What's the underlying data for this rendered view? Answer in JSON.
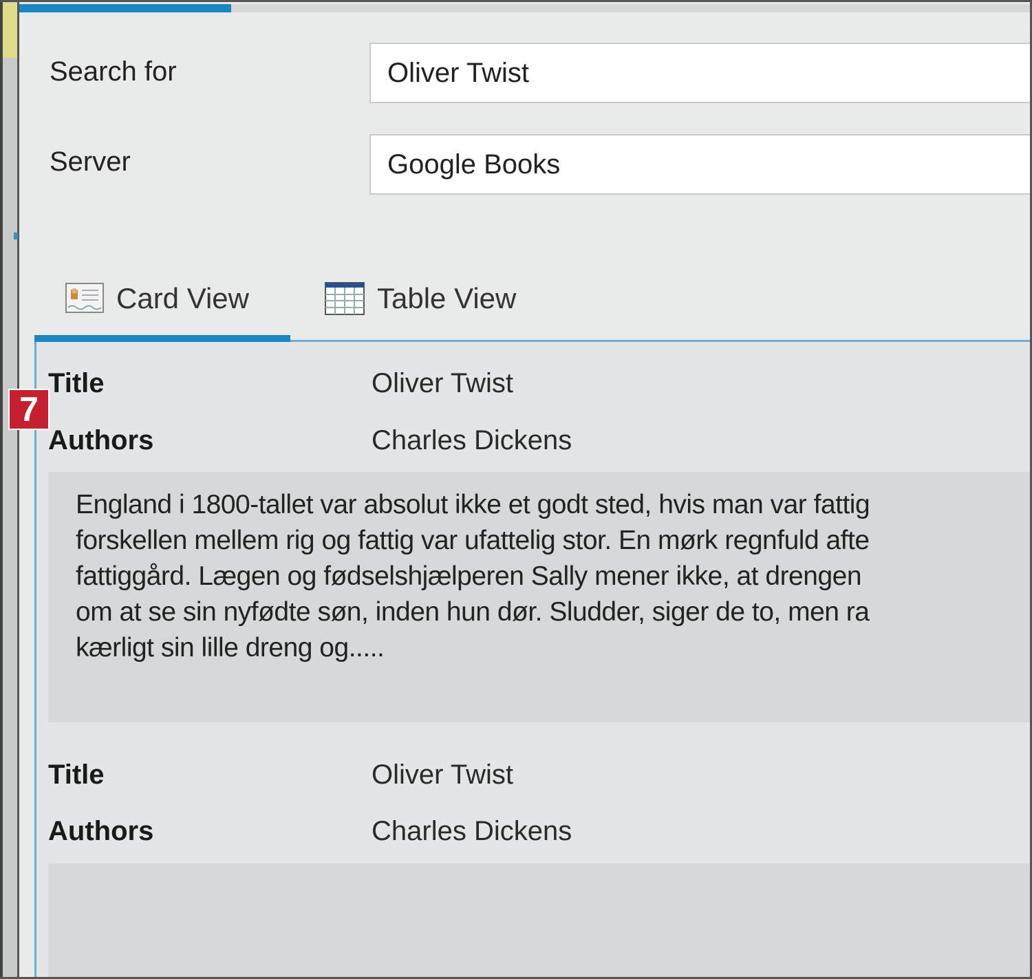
{
  "form": {
    "search_label": "Search for",
    "search_value": "Oliver Twist",
    "server_label": "Server",
    "server_value": "Google Books"
  },
  "progress_percent": 21,
  "tabs": [
    {
      "label": "Card View",
      "icon": "card-icon",
      "active": true
    },
    {
      "label": "Table View",
      "icon": "table-icon",
      "active": false
    }
  ],
  "badge": "7",
  "cards": [
    {
      "title_label": "Title",
      "title": "Oliver Twist",
      "authors_label": "Authors",
      "authors": "Charles Dickens",
      "description_lines": [
        "England i 1800-tallet var absolut ikke et godt sted, hvis man var fattig",
        "forskellen mellem rig og fattig var ufattelig stor. En mørk regnfuld afte",
        "fattiggård. Lægen og fødselshjælperen Sally mener ikke, at drengen",
        "om at se sin nyfødte søn, inden hun dør. Sludder, siger de to, men ra",
        "kærligt sin lille dreng og....."
      ]
    },
    {
      "title_label": "Title",
      "title": "Oliver Twist",
      "authors_label": "Authors",
      "authors": "Charles Dickens"
    }
  ]
}
